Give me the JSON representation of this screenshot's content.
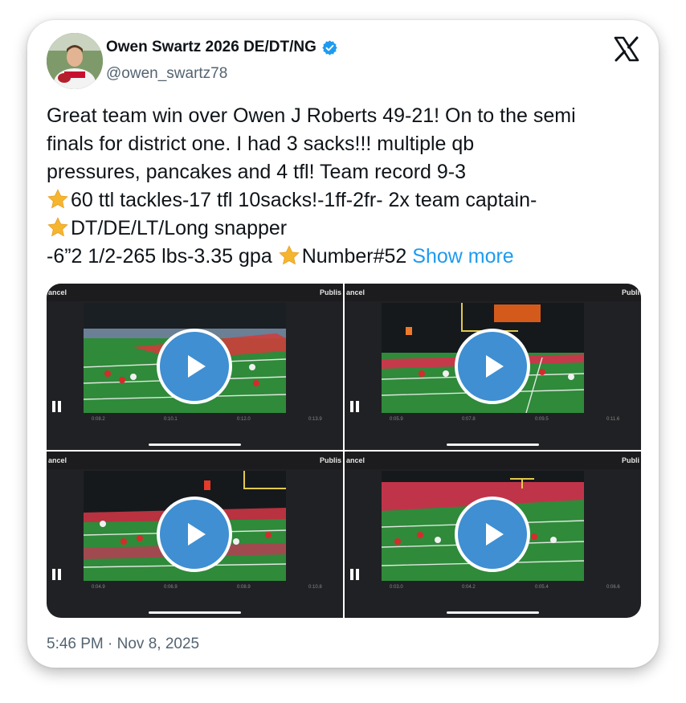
{
  "post": {
    "author_name": "Owen Swartz 2026 DE/DT/NG",
    "handle": "@owen_swartz78",
    "lines": [
      "Great team win over Owen J Roberts 49-21! On to the semi",
      "finals for district one. I had 3 sacks!!! multiple qb",
      "pressures, pancakes and 4 tfl! Team record 9-3"
    ],
    "line4": "60 ttl tackles-17 tfl 10sacks!-1ff-2fr- 2x team captain-",
    "line5": "DT/DE/LT/Long snapper",
    "line6_a": " -6”2 1/2-265 lbs-3.35 gpa ",
    "line6_b": "Number#52 ",
    "show_more": "Show more",
    "timestamp": "5:46 PM · Nov 8, 2025"
  },
  "icons": {
    "verified": "verified-badge-icon",
    "logo": "x-logo-icon",
    "emoji": "star-emoji-icon",
    "play": "play-icon"
  },
  "colors": {
    "accent": "#1d9bf0",
    "play": "#3f8fd2",
    "text": "#0f1419",
    "secondary": "#536471"
  },
  "videos": [
    {
      "left_label": "ancel",
      "right_label": "Publis",
      "times": [
        "0:08.2",
        "0:10.1",
        "0:12.0",
        "0:13.9"
      ]
    },
    {
      "left_label": "ancel",
      "right_label": "Publi",
      "times": [
        "0:05.9",
        "0:07.8",
        "0:09.5",
        "0:11.6"
      ]
    },
    {
      "left_label": "ancel",
      "right_label": "Publis",
      "times": [
        "0:04.9",
        "0:06.9",
        "0:08.9",
        "0:10.8"
      ]
    },
    {
      "left_label": "ancel",
      "right_label": "Publi",
      "times": [
        "0:03.0",
        "0:04.2",
        "0:05.4",
        "0:06.6"
      ]
    }
  ]
}
